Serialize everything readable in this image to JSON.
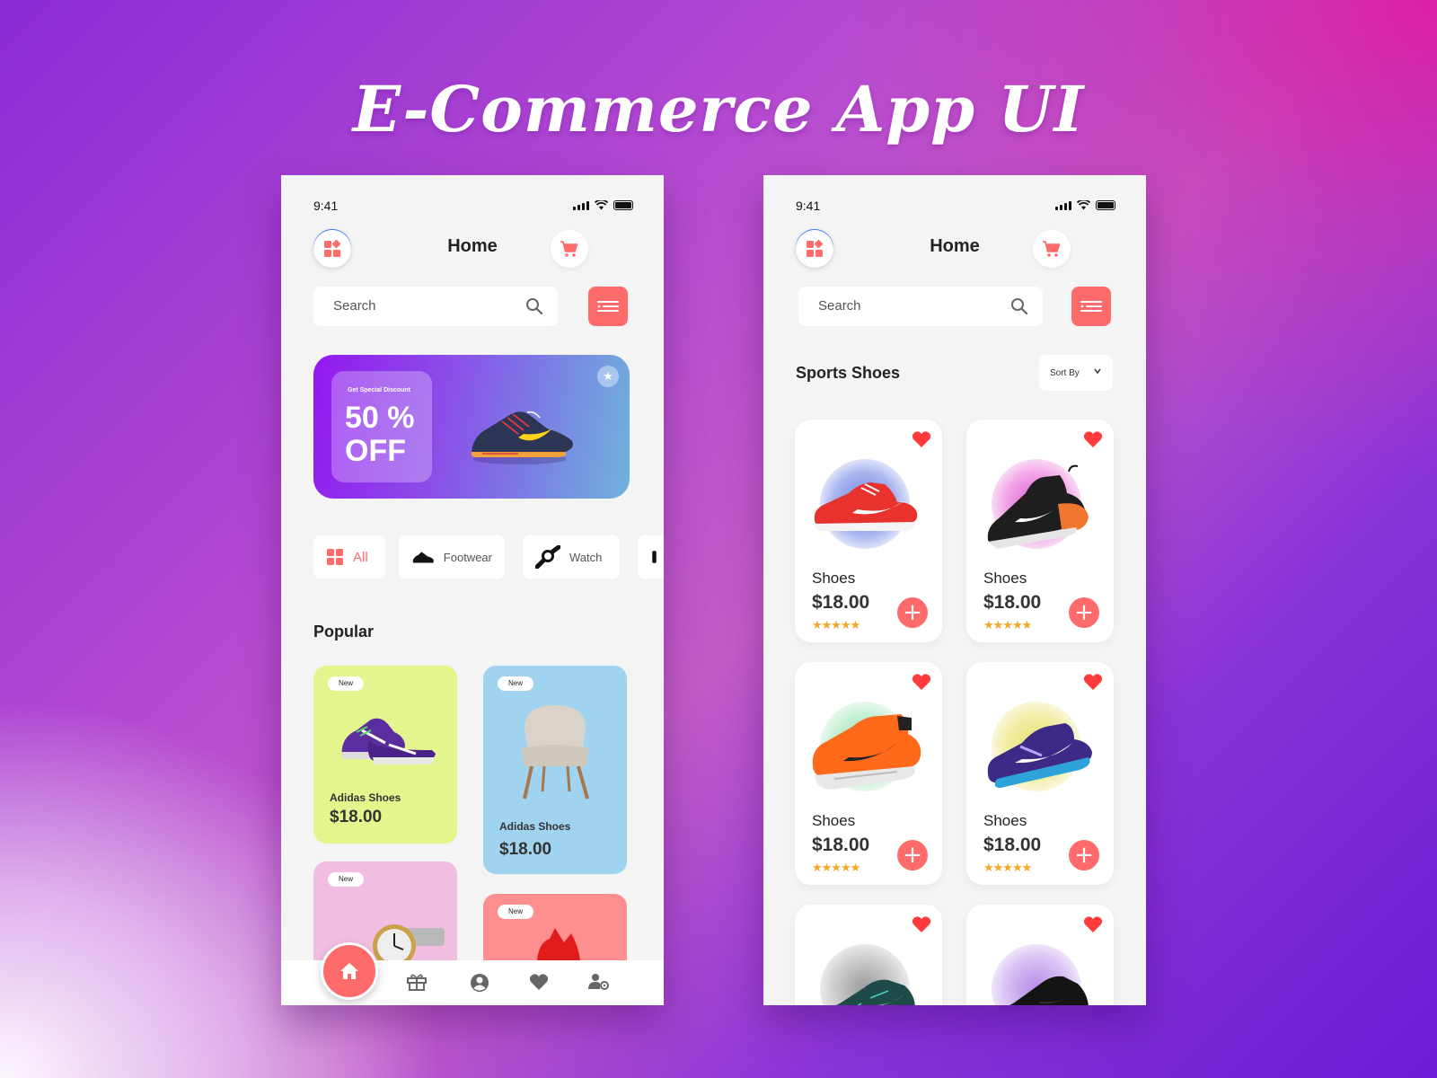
{
  "page_title": "E-Commerce App UI",
  "colors": {
    "accent": "#ff6b6b",
    "star": "#f5a623",
    "heart": "#ff3b3b"
  },
  "left": {
    "status_time": "9:41",
    "header_title": "Home",
    "search_placeholder": "Search",
    "banner": {
      "subtitle": "Get Special Discount",
      "line1": "50 %",
      "line2": "OFF"
    },
    "chips": [
      "All",
      "Footwear",
      "Watch"
    ],
    "section_title": "Popular",
    "products": [
      {
        "badge": "New",
        "name": "Adidas  Shoes",
        "price": "$18.00",
        "bg": "#e3f58c"
      },
      {
        "badge": "New",
        "name": "Adidas  Shoes",
        "price": "$18.00",
        "bg": "#9fd3f0"
      },
      {
        "badge": "New",
        "bg": "#f1bde0"
      },
      {
        "badge": "New",
        "bg": "#ff8f8f"
      }
    ],
    "nav": [
      "home-icon",
      "gift-icon",
      "profile-icon",
      "heart-icon",
      "user-settings-icon"
    ]
  },
  "right": {
    "status_time": "9:41",
    "header_title": "Home",
    "search_placeholder": "Search",
    "section_title": "Sports Shoes",
    "sort_label": "Sort By",
    "items": [
      {
        "name": "Shoes",
        "price": "$18.00",
        "rating": "★★★★★"
      },
      {
        "name": "Shoes",
        "price": "$18.00",
        "rating": "★★★★★"
      },
      {
        "name": "Shoes",
        "price": "$18.00",
        "rating": "★★★★★"
      },
      {
        "name": "Shoes",
        "price": "$18.00",
        "rating": "★★★★★"
      }
    ]
  }
}
